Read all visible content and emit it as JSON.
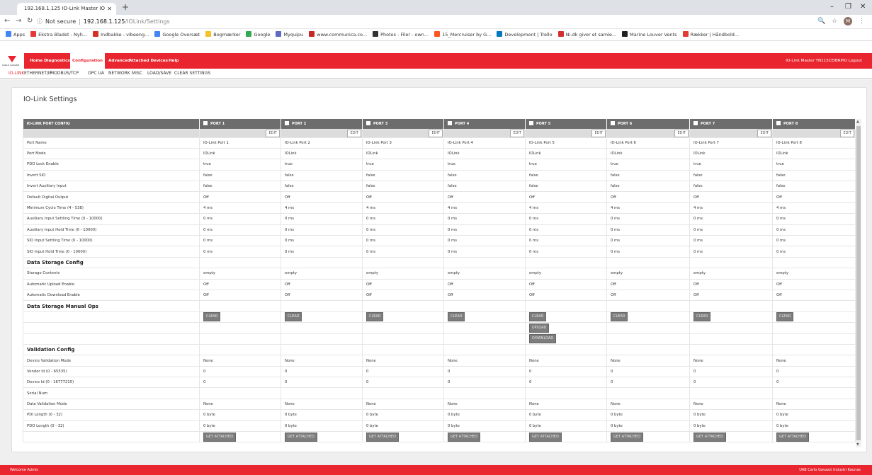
{
  "browser": {
    "tab_title": "192.168.1.125 IO-Link Master IO",
    "new_tab_symbol": "+",
    "url_not_secure": "Not secure",
    "url_host": "192.168.1.125",
    "url_path": "/IOLink/Settings",
    "profile_initial": "M",
    "bookmarks": [
      {
        "label": "Apps",
        "color": "#4285f4"
      },
      {
        "label": "Ekstra Bladet - Nyh...",
        "color": "#e53935"
      },
      {
        "label": "Indbakke - vibeeng...",
        "color": "#d93025"
      },
      {
        "label": "Google Oversæt",
        "color": "#4285f4"
      },
      {
        "label": "Bogmærker",
        "color": "#f6c026"
      },
      {
        "label": "Google",
        "color": "#34a853"
      },
      {
        "label": "Myquipu",
        "color": "#5c6bc0"
      },
      {
        "label": "www.communica.co...",
        "color": "#c62828"
      },
      {
        "label": "Photos - Filer - own...",
        "color": "#333333"
      },
      {
        "label": "15_Mercruiser by G...",
        "color": "#ff5722"
      },
      {
        "label": "Development | Trello",
        "color": "#0079bf"
      },
      {
        "label": "Ni.dk giver et samle...",
        "color": "#d32f2f"
      },
      {
        "label": "Marine Louver Vents",
        "color": "#222222"
      },
      {
        "label": "Rækker | Håndbold...",
        "color": "#e53935"
      }
    ]
  },
  "app": {
    "logo_text": "CARLO GAVAZZI",
    "menu": [
      "Home",
      "Diagnostics",
      "Configuration",
      "Advanced",
      "Attached Devices",
      "Help"
    ],
    "active_menu": "Configuration",
    "title_right": "IO-Link Master YN115CEIBRPIO  Logout",
    "submenu": [
      "IO-LINK",
      "ETHERNET/IP",
      "MODBUS/TCP",
      "OPC UA",
      "NETWORK",
      "MISC",
      "LOAD/SAVE",
      "CLEAR SETTINGS"
    ],
    "active_submenu": "IO-LINK",
    "page_title": "IO-Link Settings",
    "status_left": "Welcome Admin",
    "status_right": "UAB Carlo Gavazzi Industri Kaunas",
    "brand_color": "#e9262f"
  },
  "table": {
    "header_label": "IO-LINK PORT CONFIG",
    "ports": [
      "PORT 1",
      "PORT 2",
      "PORT 3",
      "PORT 4",
      "PORT 5",
      "PORT 6",
      "PORT 7",
      "PORT 8"
    ],
    "edit_label": "EDIT",
    "rows": [
      {
        "label": "Port Name",
        "values": [
          "IO-Link Port 1",
          "IO-Link Port 2",
          "IO-Link Port 3",
          "IO-Link Port 4",
          "IO-Link Port 5",
          "IO-Link Port 6",
          "IO-Link Port 7",
          "IO-Link Port 8"
        ]
      },
      {
        "label": "Port Mode",
        "values": [
          "IOLink",
          "IOLink",
          "IOLink",
          "IOLink",
          "IOLink",
          "IOLink",
          "IOLink",
          "IOLink"
        ]
      },
      {
        "label": "PDO Lock Enable",
        "values": [
          "true",
          "true",
          "true",
          "true",
          "true",
          "true",
          "true",
          "true"
        ]
      },
      {
        "label": "Invert SIO",
        "values": [
          "false",
          "false",
          "false",
          "false",
          "false",
          "false",
          "false",
          "false"
        ]
      },
      {
        "label": "Invert Auxiliary Input",
        "values": [
          "false",
          "false",
          "false",
          "false",
          "false",
          "false",
          "false",
          "false"
        ]
      },
      {
        "label": "Default Digital Output",
        "values": [
          "Off",
          "Off",
          "Off",
          "Off",
          "Off",
          "Off",
          "Off",
          "Off"
        ]
      },
      {
        "label": "Minimum Cycle Time (4 - 538)",
        "values": [
          "4 ms",
          "4 ms",
          "4 ms",
          "4 ms",
          "4 ms",
          "4 ms",
          "4 ms",
          "4 ms"
        ]
      },
      {
        "label": "Auxiliary Input Settling Time (0 - 10000)",
        "values": [
          "0 ms",
          "0 ms",
          "0 ms",
          "0 ms",
          "0 ms",
          "0 ms",
          "0 ms",
          "0 ms"
        ]
      },
      {
        "label": "Auxiliary Input Hold Time (0 - 10000)",
        "values": [
          "0 ms",
          "0 ms",
          "0 ms",
          "0 ms",
          "0 ms",
          "0 ms",
          "0 ms",
          "0 ms"
        ]
      },
      {
        "label": "SIO Input Settling Time (0 - 10000)",
        "values": [
          "0 ms",
          "0 ms",
          "0 ms",
          "0 ms",
          "0 ms",
          "0 ms",
          "0 ms",
          "0 ms"
        ]
      },
      {
        "label": "SIO Input Hold Time (0 - 10000)",
        "values": [
          "0 ms",
          "0 ms",
          "0 ms",
          "0 ms",
          "0 ms",
          "0 ms",
          "0 ms",
          "0 ms"
        ]
      },
      {
        "section": "Data Storage Config"
      },
      {
        "label": "Storage Contents",
        "values": [
          "empty",
          "empty",
          "empty",
          "empty",
          "empty",
          "empty",
          "empty",
          "empty"
        ]
      },
      {
        "label": "Automatic Upload Enable",
        "values": [
          "Off",
          "Off",
          "Off",
          "Off",
          "Off",
          "Off",
          "Off",
          "Off"
        ]
      },
      {
        "label": "Automatic Download Enable",
        "values": [
          "Off",
          "Off",
          "Off",
          "Off",
          "Off",
          "Off",
          "Off",
          "Off"
        ]
      },
      {
        "section": "Data Storage Manual Ops"
      },
      {
        "buttons": [
          "CLEAR",
          "CLEAR",
          "CLEAR",
          "CLEAR",
          "CLEAR",
          "CLEAR",
          "CLEAR",
          "CLEAR"
        ]
      },
      {
        "buttons": [
          "",
          "",
          "",
          "",
          "UPLOAD",
          "",
          "",
          ""
        ]
      },
      {
        "buttons": [
          "",
          "",
          "",
          "",
          "DOWNLOAD",
          "",
          "",
          ""
        ]
      },
      {
        "section": "Validation Config"
      },
      {
        "label": "Device Validation Mode",
        "values": [
          "None",
          "None",
          "None",
          "None",
          "None",
          "None",
          "None",
          "None"
        ]
      },
      {
        "label": "Vendor Id (0 - 65535)",
        "values": [
          "0",
          "0",
          "0",
          "0",
          "0",
          "0",
          "0",
          "0"
        ]
      },
      {
        "label": "Device Id (0 - 16777215)",
        "values": [
          "0",
          "0",
          "0",
          "0",
          "0",
          "0",
          "0",
          "0"
        ]
      },
      {
        "label": "Serial Num",
        "values": [
          "",
          "",
          "",
          "",
          "",
          "",
          "",
          ""
        ]
      },
      {
        "label": "Data Validation Mode",
        "values": [
          "None",
          "None",
          "None",
          "None",
          "None",
          "None",
          "None",
          "None"
        ]
      },
      {
        "label": "PDI Length (0 - 32)",
        "values": [
          "0 byte",
          "0 byte",
          "0 byte",
          "0 byte",
          "0 byte",
          "0 byte",
          "0 byte",
          "0 byte"
        ]
      },
      {
        "label": "PDO Length (0 - 32)",
        "values": [
          "0 byte",
          "0 byte",
          "0 byte",
          "0 byte",
          "0 byte",
          "0 byte",
          "0 byte",
          "0 byte"
        ]
      },
      {
        "buttons": [
          "GET ATTACHED",
          "GET ATTACHED",
          "GET ATTACHED",
          "GET ATTACHED",
          "GET ATTACHED",
          "GET ATTACHED",
          "GET ATTACHED",
          "GET ATTACHED"
        ]
      }
    ]
  }
}
